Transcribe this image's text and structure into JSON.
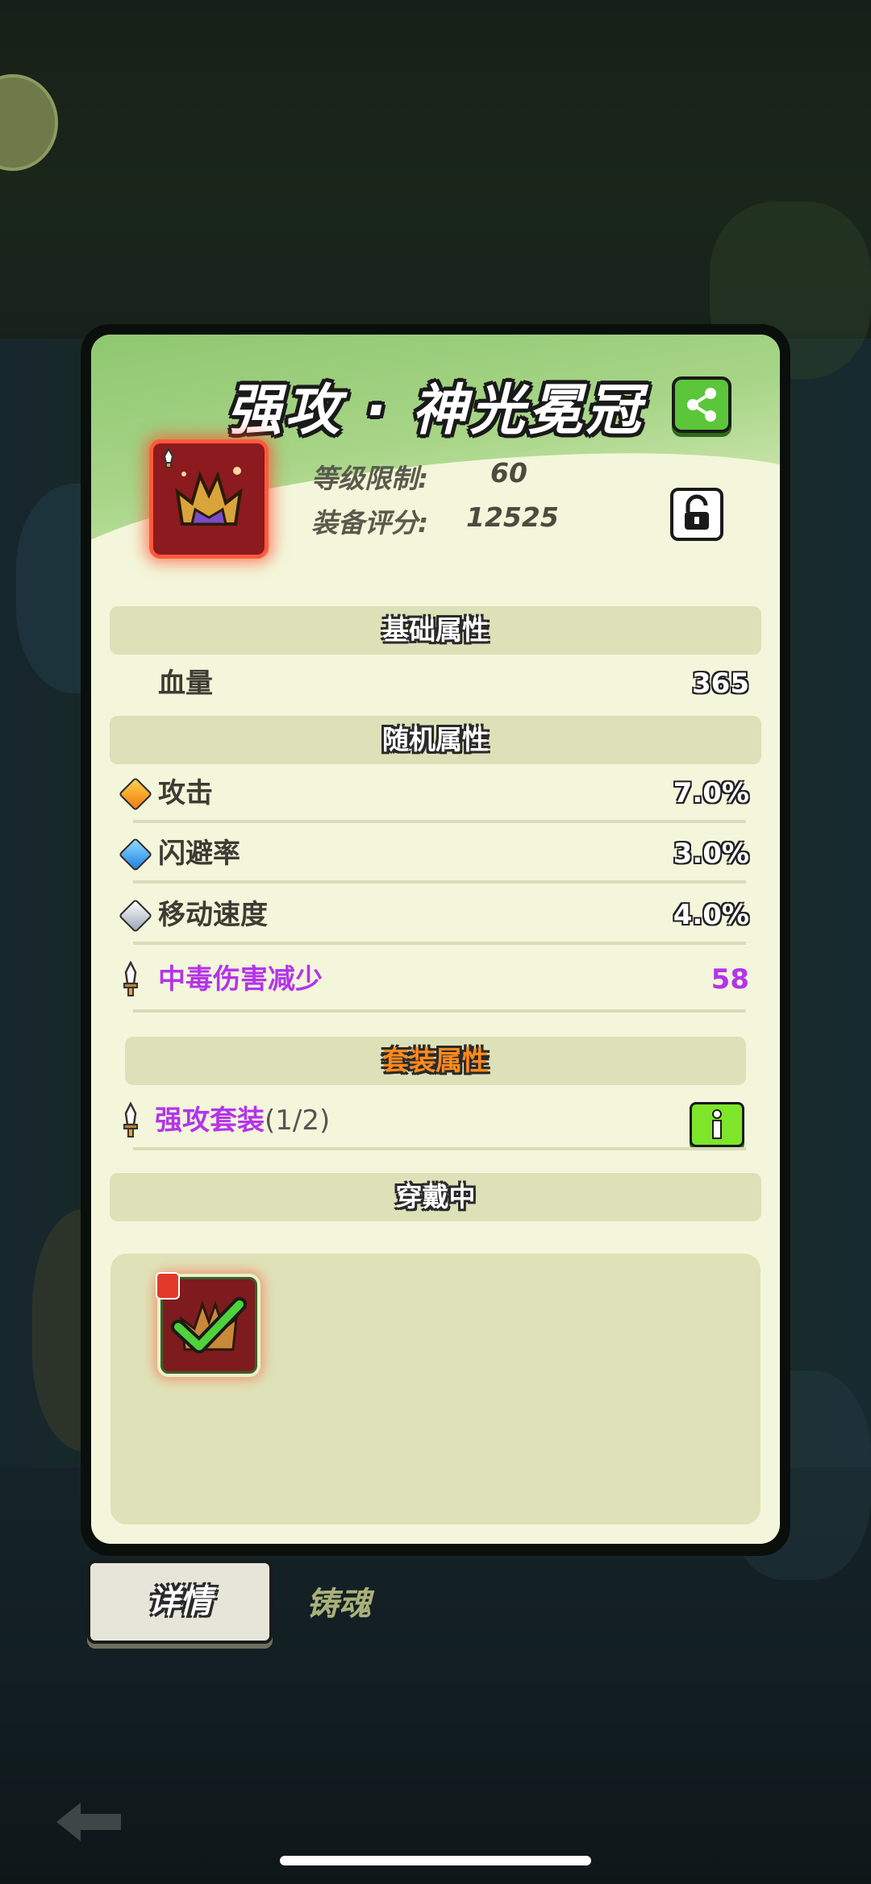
{
  "item": {
    "title": "强攻 · 神光冕冠",
    "level_limit_label": "等级限制:",
    "level_limit_value": "60",
    "score_label": "装备评分:",
    "score_value": "12525"
  },
  "sections": {
    "base": "基础属性",
    "random": "随机属性",
    "set": "套装属性",
    "wearing": "穿戴中"
  },
  "base_stats": [
    {
      "name": "血量",
      "value": "365"
    }
  ],
  "random_stats": [
    {
      "name": "攻击",
      "value": "7.0%",
      "gem": "orange-gem-icon"
    },
    {
      "name": "闪避率",
      "value": "3.0%",
      "gem": "blue-gem-icon"
    },
    {
      "name": "移动速度",
      "value": "4.0%",
      "gem": "silver-gem-icon"
    },
    {
      "name": "中毒伤害减少",
      "value": "58",
      "gem": "sword-icon"
    }
  ],
  "set_bonus": {
    "name": "强攻套装",
    "progress": "(1/2)"
  },
  "tabs": {
    "details": "详情",
    "soul_forge": "铸魂"
  },
  "colors": {
    "panel_bg": "#f3f6da",
    "section_bg": "#dde1b8",
    "purple_text": "#b434ea",
    "set_title": "#ff8a1c",
    "share_green": "#5cc63a",
    "info_green": "#7ee62a",
    "item_red": "#8c1a1e"
  }
}
